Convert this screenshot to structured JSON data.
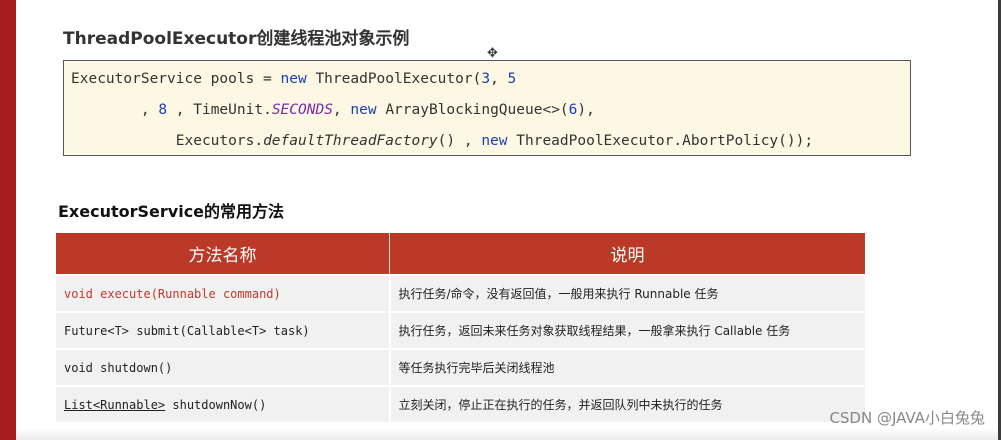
{
  "slide": {
    "title": "ThreadPoolExecutor创建线程池对象示例",
    "cursor_icon": "move-cursor-icon"
  },
  "code": {
    "line1": {
      "text1": "ExecutorService pools = ",
      "kw_new": "new",
      "text2": " ThreadPoolExecutor(",
      "num1": "3",
      "text3": ", ",
      "num2": "5"
    },
    "line2": {
      "text1": "        , ",
      "num": "8",
      "text2": " , TimeUnit.",
      "seconds": "SECONDS",
      "text3": ", ",
      "kw_new": "new",
      "text4": " ArrayBlockingQueue<>(",
      "num2": "6",
      "text5": "),"
    },
    "line3": {
      "text1": "            Executors.",
      "method": "defaultThreadFactory",
      "text2": "() , ",
      "kw_new": "new",
      "text3": " ThreadPoolExecutor.AbortPolicy());"
    }
  },
  "section_title": "ExecutorService的常用方法",
  "table": {
    "headers": [
      "方法名称",
      "说明"
    ],
    "rows": [
      {
        "method": "void execute(Runnable command)",
        "desc": "执行任务/命令，没有返回值，一般用来执行 Runnable 任务"
      },
      {
        "method": "Future<T> submit(Callable<T> task)",
        "desc": "执行任务，返回未来任务对象获取线程结果，一般拿来执行 Callable 任务"
      },
      {
        "method": "void shutdown()",
        "desc": "等任务执行完毕后关闭线程池"
      },
      {
        "method_part1": "List<Runnable>",
        "method_part2": " shutdownNow()",
        "desc": "立刻关闭，停止正在执行的任务，并返回队列中未执行的任务"
      }
    ]
  },
  "watermark": "CSDN @JAVA小白兔兔",
  "colors": {
    "accent_red": "#bb3a27",
    "code_bg": "#fcf8e3",
    "keyword_blue": "#1a3fb8",
    "italic_purple": "#7d2aa8",
    "row_bg": "#f1f1f1"
  }
}
